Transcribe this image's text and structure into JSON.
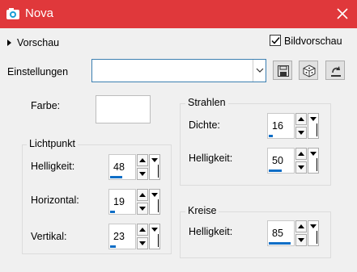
{
  "window": {
    "title": "Nova"
  },
  "top": {
    "preview_label": "Vorschau",
    "bildvorschau_label": "Bildvorschau",
    "bildvorschau_checked": true
  },
  "settings": {
    "label": "Einstellungen",
    "value": ""
  },
  "farbe": {
    "label": "Farbe:",
    "color": "#ffffff"
  },
  "lichtpunkt": {
    "legend": "Lichtpunkt",
    "helligkeit": {
      "label": "Helligkeit:",
      "value": "48",
      "level": 48
    },
    "horizontal": {
      "label": "Horizontal:",
      "value": "19",
      "level": 19
    },
    "vertikal": {
      "label": "Vertikal:",
      "value": "23",
      "level": 23
    }
  },
  "strahlen": {
    "legend": "Strahlen",
    "dichte": {
      "label": "Dichte:",
      "value": "16",
      "level": 16
    },
    "helligkeit": {
      "label": "Helligkeit:",
      "value": "50",
      "level": 50
    }
  },
  "kreise": {
    "legend": "Kreise",
    "helligkeit": {
      "label": "Helligkeit:",
      "value": "85",
      "level": 85
    }
  },
  "colors": {
    "titlebar": "#e0383b",
    "accent": "#0f6ec6"
  },
  "icons": {
    "app": "camera-icon",
    "close": "close-icon",
    "save": "save-icon",
    "random": "dice-icon",
    "reset": "reset-icon"
  }
}
